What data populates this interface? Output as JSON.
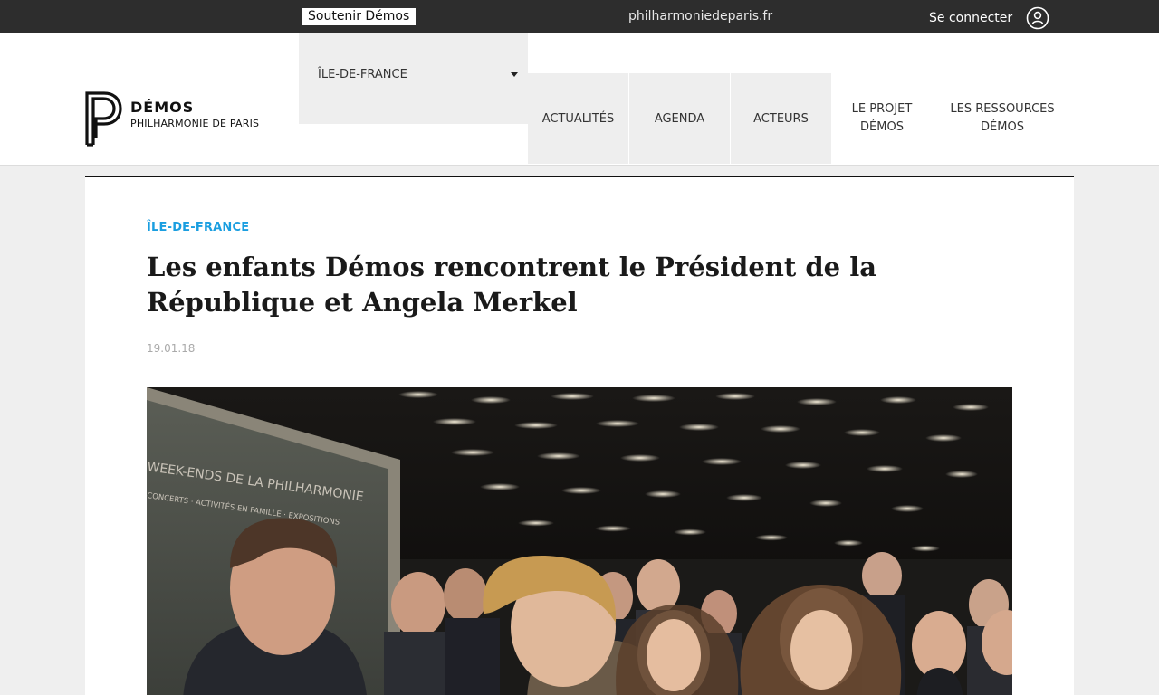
{
  "topbar": {
    "support_label": "Soutenir Démos",
    "site_link": "philharmoniedeparis.fr",
    "login_label": "Se connecter",
    "login_icon": "user-circle-icon"
  },
  "logo": {
    "title": "DÉMOS",
    "subtitle": "PHILHARMONIE DE PARIS"
  },
  "region": {
    "selected": "ÎLE-DE-FRANCE"
  },
  "nav": {
    "items": [
      {
        "label": "ACTUALITÉS"
      },
      {
        "label": "AGENDA"
      },
      {
        "label": "ACTEURS"
      },
      {
        "label_line1": "LE PROJET",
        "label_line2": "DÉMOS"
      },
      {
        "label_line1": "LES RESSOURCES",
        "label_line2": "DÉMOS"
      }
    ]
  },
  "article": {
    "category": "ÎLE-DE-FRANCE",
    "title": "Les enfants Démos rencontrent le Président de la République et Angela Merkel",
    "date": "19.01.18",
    "photo_caption_visible": {
      "poster_line1": "WEEK-ENDS DE LA PHILHARMONIE",
      "poster_line2": "CONCERTS · ACTIVITÉS EN FAMILLE · EXPOSITIONS"
    }
  },
  "colors": {
    "topbar_bg": "#2d2d2d",
    "accent": "#1a9ee0",
    "page_bg": "#efefef",
    "nav_tab_bg": "#eeeeee"
  }
}
